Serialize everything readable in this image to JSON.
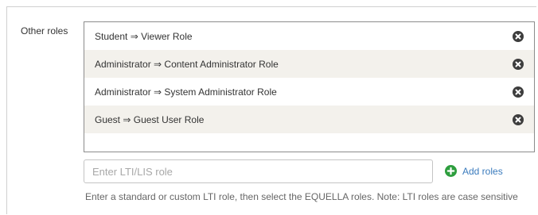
{
  "field": {
    "label": "Other roles"
  },
  "roles": [
    {
      "text": "Student ⇒ Viewer Role",
      "remove_icon": "remove-circle-icon"
    },
    {
      "text": "Administrator ⇒ Content Administrator Role",
      "remove_icon": "remove-circle-icon"
    },
    {
      "text": "Administrator ⇒ System Administrator Role",
      "remove_icon": "remove-circle-icon"
    },
    {
      "text": "Guest ⇒ Guest User Role",
      "remove_icon": "remove-circle-icon"
    }
  ],
  "input": {
    "placeholder": "Enter LTI/LIS role",
    "value": ""
  },
  "add_button": {
    "label": "Add roles",
    "icon": "add-circle-icon",
    "icon_color": "#2e9e3e",
    "label_color": "#3a7bbd"
  },
  "help": {
    "text": "Enter a standard or custom LTI role, then select the EQUELLA roles. Note: LTI roles are case sensitive"
  }
}
